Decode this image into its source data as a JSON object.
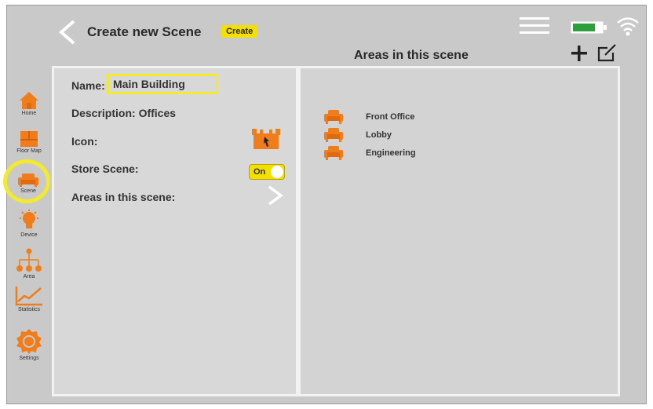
{
  "header": {
    "title": "Create new Scene",
    "create_label": "Create",
    "areas_heading": "Areas in this scene"
  },
  "icons": {
    "back": "back-chevron-icon",
    "menu": "hamburger-menu-icon",
    "battery": "battery-icon",
    "wifi": "wifi-icon",
    "add": "plus-icon",
    "edit": "edit-icon"
  },
  "colors": {
    "accent": "#f07d1a",
    "highlight": "#f2ea2a",
    "badge": "#f4e000",
    "battery": "#2e9e3c",
    "background": "#c9c9c9"
  },
  "sidebar": {
    "items": [
      {
        "label": "Home",
        "icon": "home-icon"
      },
      {
        "label": "Floor Map",
        "icon": "floor-map-icon"
      },
      {
        "label": "Scene",
        "icon": "scene-sofa-icon"
      },
      {
        "label": "Device",
        "icon": "lightbulb-icon"
      },
      {
        "label": "Area",
        "icon": "area-hierarchy-icon"
      },
      {
        "label": "Statistics",
        "icon": "statistics-chart-icon"
      },
      {
        "label": "Settings",
        "icon": "settings-gear-icon"
      }
    ],
    "selected": "Scene"
  },
  "form": {
    "name_label": "Name:",
    "name_value": "Main Building",
    "description_label": "Description: Offices",
    "icon_label": "Icon:",
    "store_label": "Store Scene:",
    "store_toggle": "On",
    "areas_label": "Areas in this scene:"
  },
  "areas": [
    {
      "label": "Front Office",
      "icon": "sofa-icon"
    },
    {
      "label": "Lobby",
      "icon": "sofa-icon"
    },
    {
      "label": "Engineering",
      "icon": "sofa-icon"
    }
  ]
}
